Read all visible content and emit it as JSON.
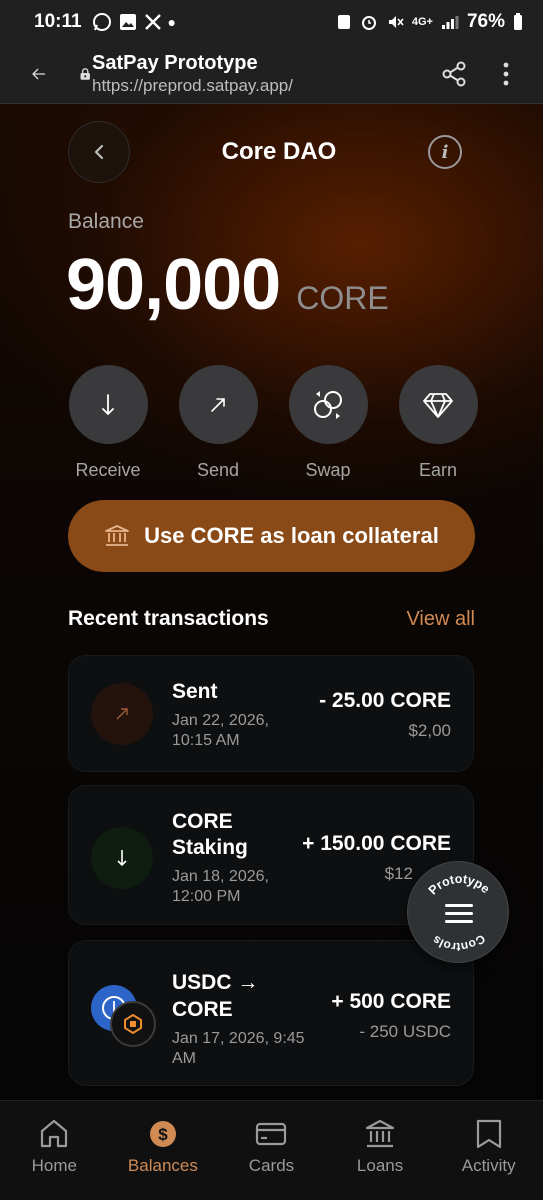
{
  "status_bar": {
    "time": "10:11",
    "battery": "76%",
    "network": "4G+"
  },
  "browser": {
    "title": "SatPay Prototype",
    "url": "https://preprod.satpay.app/"
  },
  "header": {
    "title": "Core DAO"
  },
  "balance": {
    "label": "Balance",
    "amount": "90,000",
    "unit": "CORE"
  },
  "actions": [
    {
      "label": "Receive",
      "icon": "arrow-down-icon"
    },
    {
      "label": "Send",
      "icon": "arrow-up-right-icon"
    },
    {
      "label": "Swap",
      "icon": "swap-icon"
    },
    {
      "label": "Earn",
      "icon": "diamond-icon"
    }
  ],
  "loan_button": {
    "label": "Use CORE as loan collateral"
  },
  "recent": {
    "title": "Recent transactions",
    "view_all": "View all"
  },
  "transactions": [
    {
      "name": "Sent",
      "date": "Jan 22, 2026,",
      "time": "10:15 AM",
      "amount": "- 25.00 CORE",
      "sub": "$2,00"
    },
    {
      "name_line1": "CORE",
      "name_line2": "Staking",
      "date": "Jan 18, 2026,",
      "time": "12:00 PM",
      "amount": "+ 150.00 CORE",
      "sub": "$12"
    },
    {
      "name_line1": "USDC →",
      "name_line2": "CORE",
      "date": "Jan 17, 2026, 9:45",
      "time": "AM",
      "amount": "+ 500 CORE",
      "sub": "- 250 USDC"
    }
  ],
  "fab": {
    "top_text": "Prototype",
    "bottom_text": "Controls"
  },
  "tabs": [
    {
      "label": "Home",
      "icon": "home-icon"
    },
    {
      "label": "Balances",
      "icon": "dollar-icon",
      "active": true
    },
    {
      "label": "Cards",
      "icon": "card-icon"
    },
    {
      "label": "Loans",
      "icon": "bank-icon"
    },
    {
      "label": "Activity",
      "icon": "receipt-icon"
    }
  ],
  "colors": {
    "accent": "#d08a54",
    "loan_button": "#8a4a17",
    "send_red": "#2a1612",
    "stake_green": "#0f1f12"
  }
}
